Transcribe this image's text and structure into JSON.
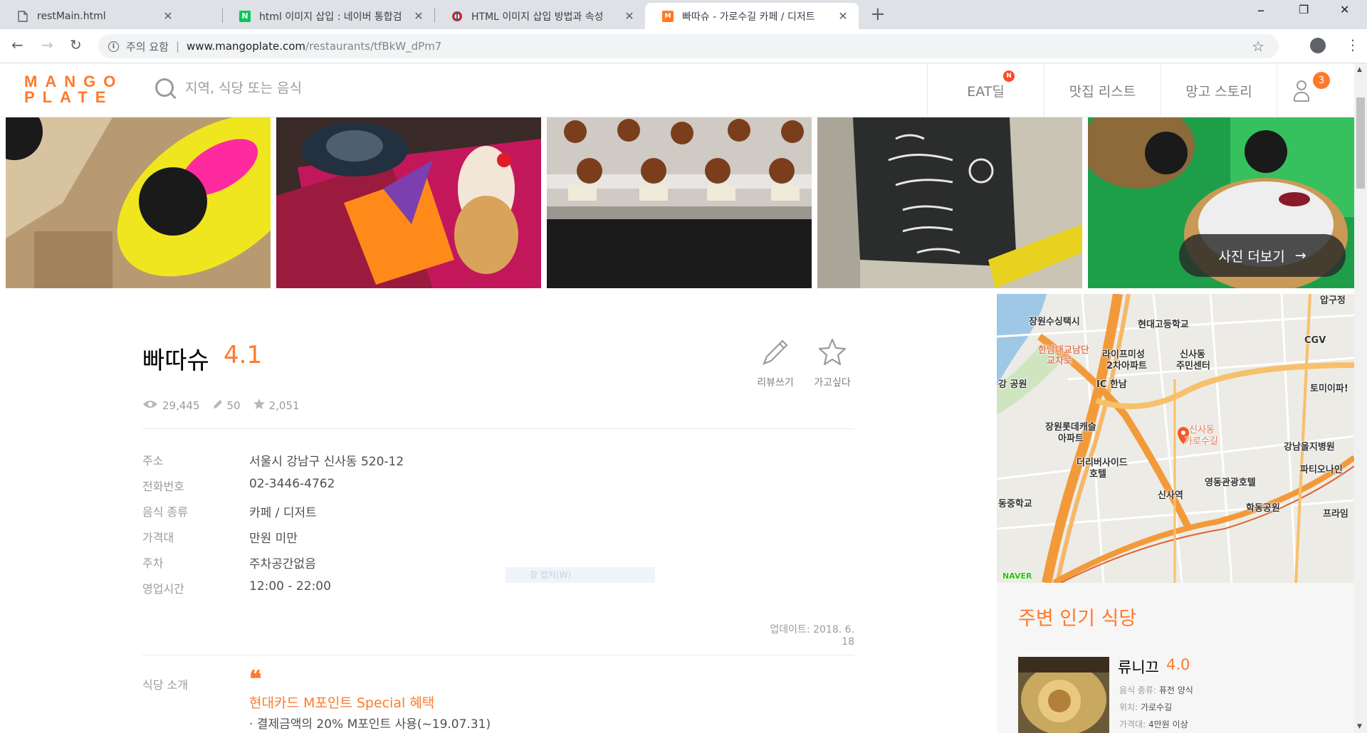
{
  "browser": {
    "tabs": [
      {
        "title": "restMain.html",
        "favicon": "file-icon"
      },
      {
        "title": "html 이미지 삽입 : 네이버 통합검",
        "favicon": "naver-icon",
        "favicon_text": "N"
      },
      {
        "title": "HTML 이미지 삽입 방법과 속성",
        "favicon": "site-icon"
      },
      {
        "title": "빠따슈 - 가로수길 카페 / 디저트",
        "favicon": "mangoplate-icon",
        "active": true
      }
    ],
    "url": {
      "security_label": "주의 요함",
      "pipe": "|",
      "host": "www.mangoplate.com",
      "path": "/restaurants/tfBkW_dPm7"
    }
  },
  "header": {
    "logo_line1": "MANGO",
    "logo_line2": "PLATE",
    "search_placeholder": "지역, 식당 또는 음식",
    "nav": [
      {
        "label": "EAT딜",
        "badge": "N"
      },
      {
        "label": "맛집 리스트"
      },
      {
        "label": "망고 스토리"
      }
    ],
    "user_badge": "3"
  },
  "photos": {
    "more_label": "사진 더보기",
    "more_arrow": "→"
  },
  "restaurant": {
    "name": "빠따슈",
    "score": "4.1",
    "actions": [
      {
        "label": "리뷰쓰기",
        "icon": "pencil-icon"
      },
      {
        "label": "가고싶다",
        "icon": "star-icon"
      }
    ],
    "stats": {
      "views": "29,445",
      "reviews": "50",
      "wishes": "2,051"
    },
    "info": [
      {
        "key": "주소",
        "value": "서울시 강남구 신사동 520-12"
      },
      {
        "key": "전화번호",
        "value": "02-3446-4762"
      },
      {
        "key": "음식 종류",
        "value": "카페 / 디저트"
      },
      {
        "key": "가격대",
        "value": "만원 미만"
      },
      {
        "key": "주차",
        "value": "주차공간없음"
      },
      {
        "key": "영업시간",
        "value": "12:00 - 22:00"
      }
    ],
    "capture_hint": "창 캡처(W)",
    "updated": "업데이트: 2018. 6. 18",
    "intro": {
      "key": "식당 소개",
      "quote": "❝",
      "title": "현대카드 M포인트 Special 혜택",
      "line": "· 결제금액의 20% M포인트 사용(~19.07.31)"
    }
  },
  "map": {
    "labels": [
      "장원수싱택시",
      "현대고등학교",
      "한남대교남단",
      "교차로",
      "라이프미성",
      "2차아파트",
      "신사동",
      "주민센터",
      "CGV",
      "강 공원",
      "IC 한남",
      "토미이파!",
      "장원롯데캐슬",
      "아파트",
      "신사동",
      "가로수길",
      "강남을지병원",
      "더리버사이드",
      "호텔",
      "파티오나인",
      "영동관광호텔",
      "동중학교",
      "신사역",
      "학동공원",
      "프라임",
      "압구정"
    ],
    "provider": "NAVER"
  },
  "side": {
    "title": "주변 인기 식당",
    "popular": [
      {
        "name": "류니끄",
        "score": "4.0",
        "food_key": "음식 종류:",
        "food": "퓨전 양식",
        "loc_key": "위치:",
        "loc": "가로수길",
        "price_key": "가격대:",
        "price": "4만원 이상"
      }
    ]
  },
  "colors": {
    "brand": "#ff792a",
    "muted": "#9b9b9b"
  }
}
